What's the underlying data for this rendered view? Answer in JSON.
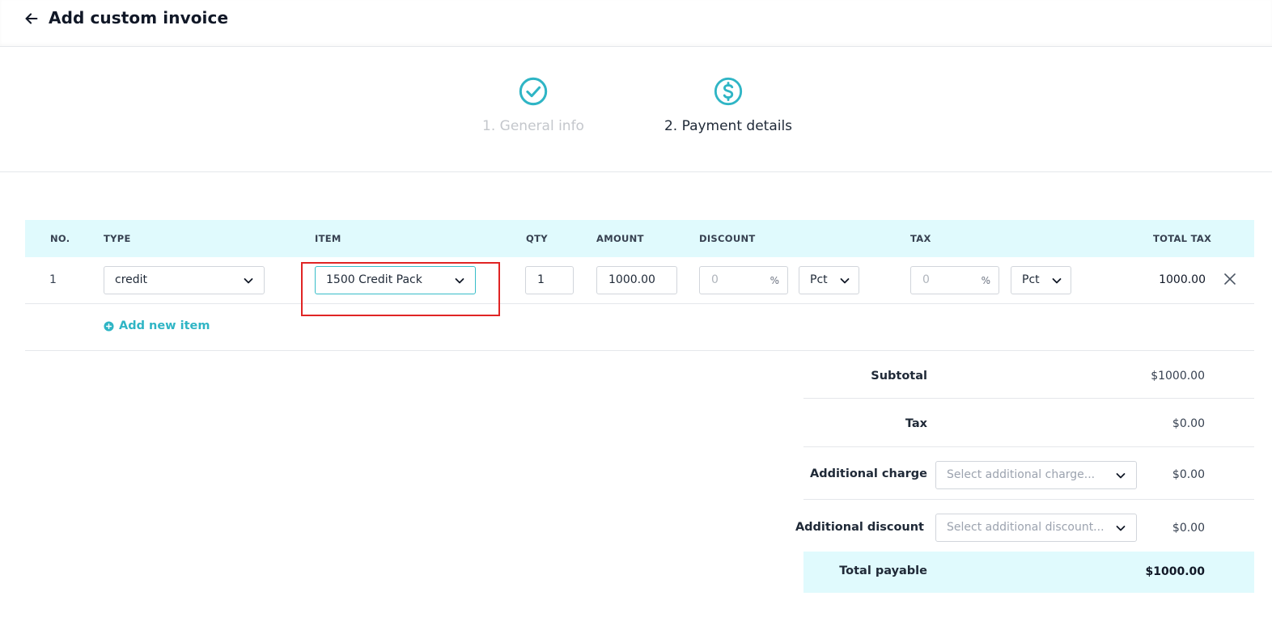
{
  "header": {
    "title": "Add custom invoice"
  },
  "stepper": {
    "steps": [
      {
        "label": "1. General info",
        "state": "completed"
      },
      {
        "label": "2. Payment details",
        "state": "active"
      }
    ],
    "accent_color": "#2fb5c5"
  },
  "table": {
    "columns": [
      "NO.",
      "TYPE",
      "ITEM",
      "QTY",
      "AMOUNT",
      "DISCOUNT",
      "TAX",
      "TOTAL TAX"
    ],
    "rows": [
      {
        "no": "1",
        "type": "credit",
        "item": "1500 Credit Pack",
        "qty": "1",
        "amount": "1000.00",
        "discount_placeholder": "0",
        "discount_suffix": "%",
        "discount_mode": "Pct",
        "tax_placeholder": "0",
        "tax_suffix": "%",
        "tax_mode": "Pct",
        "total_tax": "1000.00"
      }
    ],
    "add_item_label": "Add new item"
  },
  "summary": {
    "subtotal_label": "Subtotal",
    "subtotal_value": "$1000.00",
    "tax_label": "Tax",
    "tax_value": "$0.00",
    "additional_charge_label": "Additional charge",
    "additional_charge_placeholder": "Select additional charge...",
    "additional_charge_value": "$0.00",
    "additional_discount_label": "Additional discount",
    "additional_discount_placeholder": "Select additional discount...",
    "additional_discount_value": "$0.00",
    "total_label": "Total payable",
    "total_value": "$1000.00"
  },
  "colors": {
    "accent": "#2fb5c5",
    "header_bg": "#e0fafd",
    "highlight": "#e02424"
  }
}
